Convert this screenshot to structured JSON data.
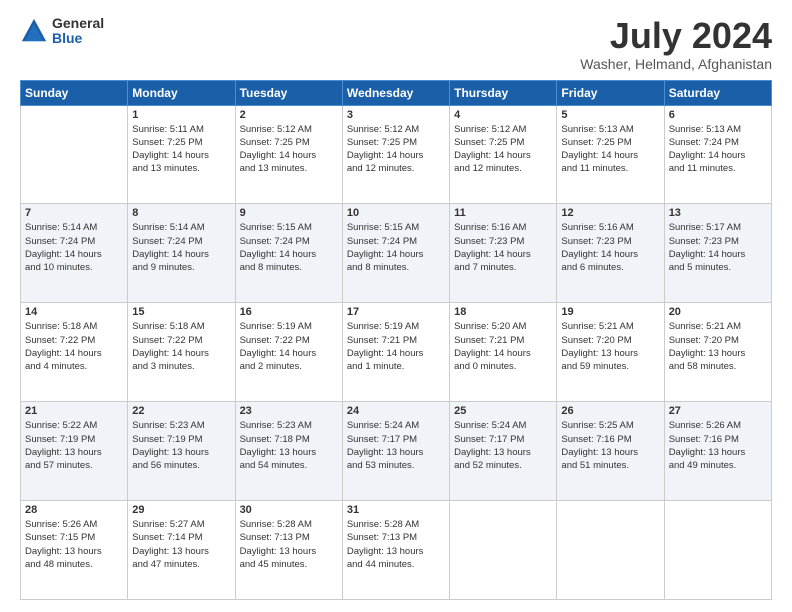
{
  "logo": {
    "general": "General",
    "blue": "Blue"
  },
  "title": "July 2024",
  "subtitle": "Washer, Helmand, Afghanistan",
  "headers": [
    "Sunday",
    "Monday",
    "Tuesday",
    "Wednesday",
    "Thursday",
    "Friday",
    "Saturday"
  ],
  "weeks": [
    [
      {
        "day": "",
        "info": ""
      },
      {
        "day": "1",
        "info": "Sunrise: 5:11 AM\nSunset: 7:25 PM\nDaylight: 14 hours\nand 13 minutes."
      },
      {
        "day": "2",
        "info": "Sunrise: 5:12 AM\nSunset: 7:25 PM\nDaylight: 14 hours\nand 13 minutes."
      },
      {
        "day": "3",
        "info": "Sunrise: 5:12 AM\nSunset: 7:25 PM\nDaylight: 14 hours\nand 12 minutes."
      },
      {
        "day": "4",
        "info": "Sunrise: 5:12 AM\nSunset: 7:25 PM\nDaylight: 14 hours\nand 12 minutes."
      },
      {
        "day": "5",
        "info": "Sunrise: 5:13 AM\nSunset: 7:25 PM\nDaylight: 14 hours\nand 11 minutes."
      },
      {
        "day": "6",
        "info": "Sunrise: 5:13 AM\nSunset: 7:24 PM\nDaylight: 14 hours\nand 11 minutes."
      }
    ],
    [
      {
        "day": "7",
        "info": "Sunrise: 5:14 AM\nSunset: 7:24 PM\nDaylight: 14 hours\nand 10 minutes."
      },
      {
        "day": "8",
        "info": "Sunrise: 5:14 AM\nSunset: 7:24 PM\nDaylight: 14 hours\nand 9 minutes."
      },
      {
        "day": "9",
        "info": "Sunrise: 5:15 AM\nSunset: 7:24 PM\nDaylight: 14 hours\nand 8 minutes."
      },
      {
        "day": "10",
        "info": "Sunrise: 5:15 AM\nSunset: 7:24 PM\nDaylight: 14 hours\nand 8 minutes."
      },
      {
        "day": "11",
        "info": "Sunrise: 5:16 AM\nSunset: 7:23 PM\nDaylight: 14 hours\nand 7 minutes."
      },
      {
        "day": "12",
        "info": "Sunrise: 5:16 AM\nSunset: 7:23 PM\nDaylight: 14 hours\nand 6 minutes."
      },
      {
        "day": "13",
        "info": "Sunrise: 5:17 AM\nSunset: 7:23 PM\nDaylight: 14 hours\nand 5 minutes."
      }
    ],
    [
      {
        "day": "14",
        "info": "Sunrise: 5:18 AM\nSunset: 7:22 PM\nDaylight: 14 hours\nand 4 minutes."
      },
      {
        "day": "15",
        "info": "Sunrise: 5:18 AM\nSunset: 7:22 PM\nDaylight: 14 hours\nand 3 minutes."
      },
      {
        "day": "16",
        "info": "Sunrise: 5:19 AM\nSunset: 7:22 PM\nDaylight: 14 hours\nand 2 minutes."
      },
      {
        "day": "17",
        "info": "Sunrise: 5:19 AM\nSunset: 7:21 PM\nDaylight: 14 hours\nand 1 minute."
      },
      {
        "day": "18",
        "info": "Sunrise: 5:20 AM\nSunset: 7:21 PM\nDaylight: 14 hours\nand 0 minutes."
      },
      {
        "day": "19",
        "info": "Sunrise: 5:21 AM\nSunset: 7:20 PM\nDaylight: 13 hours\nand 59 minutes."
      },
      {
        "day": "20",
        "info": "Sunrise: 5:21 AM\nSunset: 7:20 PM\nDaylight: 13 hours\nand 58 minutes."
      }
    ],
    [
      {
        "day": "21",
        "info": "Sunrise: 5:22 AM\nSunset: 7:19 PM\nDaylight: 13 hours\nand 57 minutes."
      },
      {
        "day": "22",
        "info": "Sunrise: 5:23 AM\nSunset: 7:19 PM\nDaylight: 13 hours\nand 56 minutes."
      },
      {
        "day": "23",
        "info": "Sunrise: 5:23 AM\nSunset: 7:18 PM\nDaylight: 13 hours\nand 54 minutes."
      },
      {
        "day": "24",
        "info": "Sunrise: 5:24 AM\nSunset: 7:17 PM\nDaylight: 13 hours\nand 53 minutes."
      },
      {
        "day": "25",
        "info": "Sunrise: 5:24 AM\nSunset: 7:17 PM\nDaylight: 13 hours\nand 52 minutes."
      },
      {
        "day": "26",
        "info": "Sunrise: 5:25 AM\nSunset: 7:16 PM\nDaylight: 13 hours\nand 51 minutes."
      },
      {
        "day": "27",
        "info": "Sunrise: 5:26 AM\nSunset: 7:16 PM\nDaylight: 13 hours\nand 49 minutes."
      }
    ],
    [
      {
        "day": "28",
        "info": "Sunrise: 5:26 AM\nSunset: 7:15 PM\nDaylight: 13 hours\nand 48 minutes."
      },
      {
        "day": "29",
        "info": "Sunrise: 5:27 AM\nSunset: 7:14 PM\nDaylight: 13 hours\nand 47 minutes."
      },
      {
        "day": "30",
        "info": "Sunrise: 5:28 AM\nSunset: 7:13 PM\nDaylight: 13 hours\nand 45 minutes."
      },
      {
        "day": "31",
        "info": "Sunrise: 5:28 AM\nSunset: 7:13 PM\nDaylight: 13 hours\nand 44 minutes."
      },
      {
        "day": "",
        "info": ""
      },
      {
        "day": "",
        "info": ""
      },
      {
        "day": "",
        "info": ""
      }
    ]
  ]
}
